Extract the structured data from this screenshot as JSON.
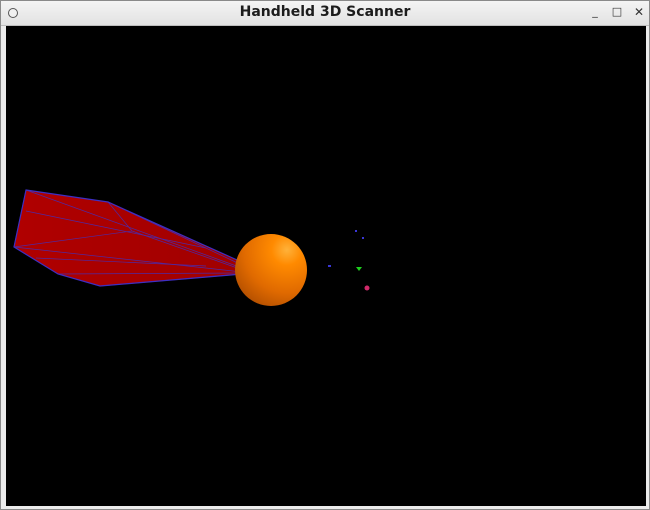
{
  "window": {
    "title": "Handheld 3D Scanner",
    "controls": {
      "menu_icon": "window-menu-icon",
      "minimize_glyph": "_",
      "maximize_glyph": "□",
      "close_glyph": "✕"
    }
  },
  "scene": {
    "background_color": "#000000",
    "frustum_fill_color": "#a80000",
    "frustum_edge_color": "#3d2fc4",
    "sphere_color": "#e86a00",
    "sphere_highlight_color": "#ff9a1a",
    "point_colors": [
      "#3a37d6",
      "#3a37d6",
      "#3a37d6",
      "#1ed01e",
      "#d02a6a"
    ]
  }
}
